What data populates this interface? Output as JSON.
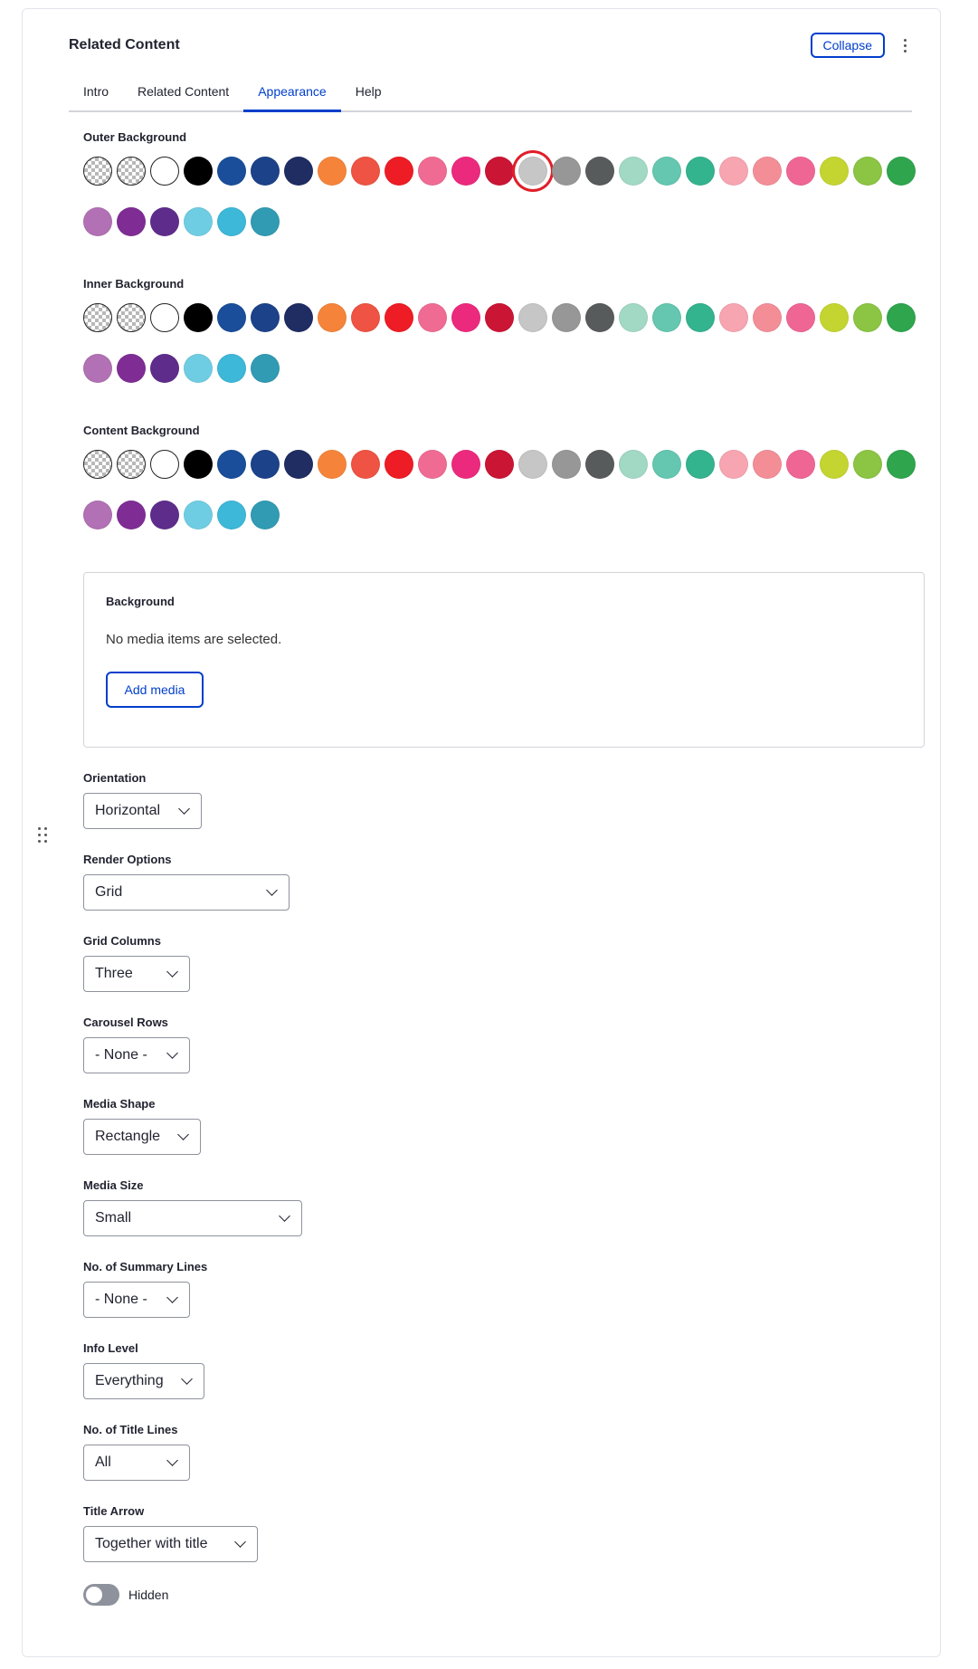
{
  "header": {
    "title": "Related Content",
    "collapse_label": "Collapse"
  },
  "tabs": [
    {
      "label": "Intro",
      "active": false
    },
    {
      "label": "Related Content",
      "active": false
    },
    {
      "label": "Appearance",
      "active": true
    },
    {
      "label": "Help",
      "active": false
    }
  ],
  "palette": [
    "transparent",
    "transparent",
    "#ffffff",
    "#000000",
    "#1a4e9a",
    "#1c428a",
    "#1f2d63",
    "#f5843a",
    "#ef5343",
    "#ee1c25",
    "#f06b93",
    "#ec2a7d",
    "#cb1535",
    "#c6c6c6",
    "#979797",
    "#585b5c",
    "#a2d9c5",
    "#65c7b0",
    "#34b38f",
    "#f7a5b1",
    "#f38e97",
    "#ef6694",
    "#c4d531",
    "#8bc543",
    "#2fa54d",
    "#b171b4",
    "#7f2d95",
    "#5e2d8c",
    "#6fcde3",
    "#3db8d9",
    "#319bb3"
  ],
  "backgrounds": [
    {
      "label": "Outer Background",
      "selected_index": 13
    },
    {
      "label": "Inner Background",
      "selected_index": -1
    },
    {
      "label": "Content Background",
      "selected_index": -1
    }
  ],
  "media": {
    "title": "Background",
    "empty_text": "No media items are selected.",
    "add_label": "Add media"
  },
  "fields": {
    "orientation": {
      "label": "Orientation",
      "value": "Horizontal"
    },
    "render_options": {
      "label": "Render Options",
      "value": "Grid"
    },
    "grid_columns": {
      "label": "Grid Columns",
      "value": "Three"
    },
    "carousel_rows": {
      "label": "Carousel Rows",
      "value": "- None -"
    },
    "media_shape": {
      "label": "Media Shape",
      "value": "Rectangle"
    },
    "media_size": {
      "label": "Media Size",
      "value": "Small"
    },
    "summary_lines": {
      "label": "No. of Summary Lines",
      "value": "- None -"
    },
    "info_level": {
      "label": "Info Level",
      "value": "Everything"
    },
    "title_lines": {
      "label": "No. of Title Lines",
      "value": "All"
    },
    "title_arrow": {
      "label": "Title Arrow",
      "value": "Together with title"
    }
  },
  "toggle": {
    "label": "Hidden",
    "on": false
  },
  "colors": {
    "accent": "#003ecc",
    "selected_ring": "#e01e2a",
    "border": "#d3d4d9"
  }
}
